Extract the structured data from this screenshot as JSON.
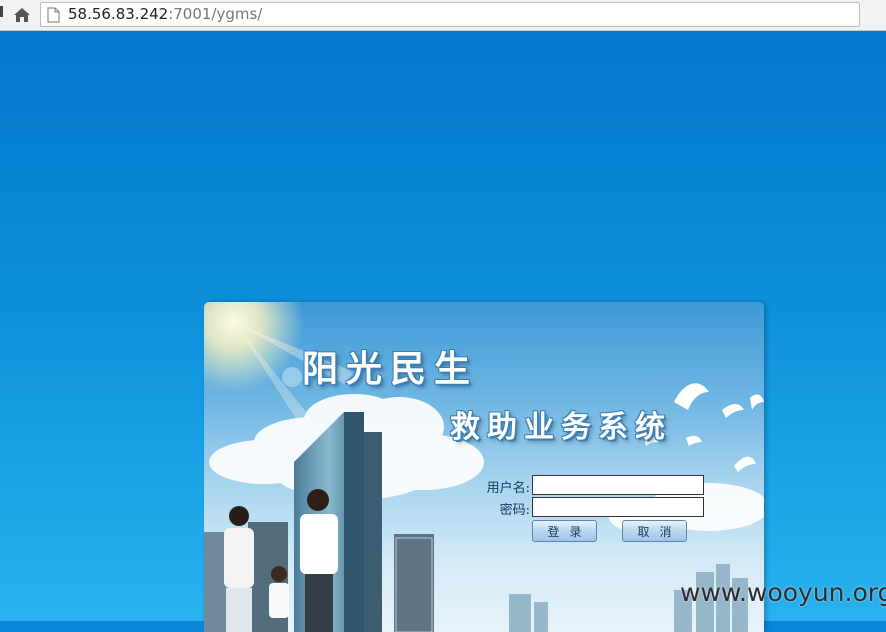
{
  "browser": {
    "url_host": "58.56.83.242",
    "url_path": ":7001/ygms/"
  },
  "login": {
    "title_main": "阳光民生",
    "title_sub": "救助业务系统",
    "username_label": "用户名:",
    "password_label": "密码:",
    "username_value": "",
    "password_value": "",
    "login_button": "登录",
    "cancel_button": "取消"
  },
  "watermark": "www.wooyun.org",
  "colors": {
    "page_background": "#0a86d6",
    "title_outline": "#3a7fb5",
    "label_text": "#123a66"
  }
}
